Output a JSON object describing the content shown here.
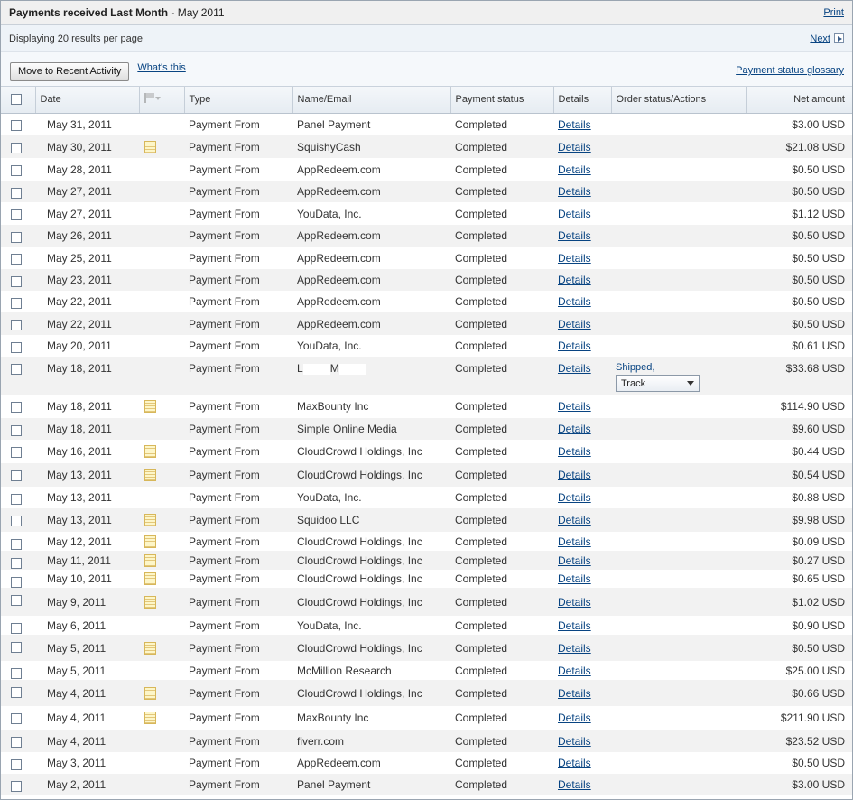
{
  "header": {
    "title_bold": "Payments received Last Month",
    "title_suffix": " - May 2011",
    "print_label": "Print"
  },
  "info": {
    "results_text": "Displaying 20 results per page",
    "next_label": "Next"
  },
  "actions": {
    "move_button": "Move to Recent Activity",
    "whats_this": "What's this",
    "glossary": "Payment status glossary"
  },
  "columns": {
    "date": "Date",
    "type": "Type",
    "name": "Name/Email",
    "status": "Payment status",
    "details": "Details",
    "order": "Order status/Actions",
    "amount": "Net amount"
  },
  "rows": [
    {
      "date": "May 31, 2011",
      "note": false,
      "type": "Payment From",
      "name": "Panel Payment",
      "status": "Completed",
      "details": "Details",
      "amount": "$3.00 USD"
    },
    {
      "date": "May 30, 2011",
      "note": true,
      "type": "Payment From",
      "name": "SquishyCash",
      "status": "Completed",
      "details": "Details",
      "amount": "$21.08 USD"
    },
    {
      "date": "May 28, 2011",
      "note": false,
      "type": "Payment From",
      "name": "AppRedeem.com",
      "status": "Completed",
      "details": "Details",
      "amount": "$0.50 USD"
    },
    {
      "date": "May 27, 2011",
      "note": false,
      "type": "Payment From",
      "name": "AppRedeem.com",
      "status": "Completed",
      "details": "Details",
      "amount": "$0.50 USD"
    },
    {
      "date": "May 27, 2011",
      "note": false,
      "type": "Payment From",
      "name": "YouData, Inc.",
      "status": "Completed",
      "details": "Details",
      "amount": "$1.12 USD"
    },
    {
      "date": "May 26, 2011",
      "note": false,
      "type": "Payment From",
      "name": "AppRedeem.com",
      "status": "Completed",
      "details": "Details",
      "amount": "$0.50 USD"
    },
    {
      "date": "May 25, 2011",
      "note": false,
      "type": "Payment From",
      "name": "AppRedeem.com",
      "status": "Completed",
      "details": "Details",
      "amount": "$0.50 USD"
    },
    {
      "date": "May 23, 2011",
      "note": false,
      "type": "Payment From",
      "name": "AppRedeem.com",
      "status": "Completed",
      "details": "Details",
      "amount": "$0.50 USD"
    },
    {
      "date": "May 22, 2011",
      "note": false,
      "type": "Payment From",
      "name": "AppRedeem.com",
      "status": "Completed",
      "details": "Details",
      "amount": "$0.50 USD"
    },
    {
      "date": "May 22, 2011",
      "note": false,
      "type": "Payment From",
      "name": "AppRedeem.com",
      "status": "Completed",
      "details": "Details",
      "amount": "$0.50 USD"
    },
    {
      "date": "May 20, 2011",
      "note": false,
      "type": "Payment From",
      "name": "YouData, Inc.",
      "status": "Completed",
      "details": "Details",
      "amount": "$0.61 USD"
    },
    {
      "date": "May 18, 2011",
      "note": false,
      "type": "Payment From",
      "name": "L M",
      "name_a": "L",
      "name_b": "M",
      "redacted": true,
      "status": "Completed",
      "details": "Details",
      "order_status": "Shipped",
      "order_action": "Track",
      "amount": "$33.68 USD"
    },
    {
      "date": "May 18, 2011",
      "note": true,
      "type": "Payment From",
      "name": "MaxBounty Inc",
      "status": "Completed",
      "details": "Details",
      "amount": "$114.90 USD"
    },
    {
      "date": "May 18, 2011",
      "note": false,
      "type": "Payment From",
      "name": "Simple Online Media",
      "status": "Completed",
      "details": "Details",
      "amount": "$9.60 USD"
    },
    {
      "date": "May 16, 2011",
      "note": true,
      "type": "Payment From",
      "name": "CloudCrowd Holdings, Inc",
      "status": "Completed",
      "details": "Details",
      "amount": "$0.44 USD"
    },
    {
      "date": "May 13, 2011",
      "note": true,
      "type": "Payment From",
      "name": "CloudCrowd Holdings, Inc",
      "status": "Completed",
      "details": "Details",
      "amount": "$0.54 USD"
    },
    {
      "date": "May 13, 2011",
      "note": false,
      "type": "Payment From",
      "name": "YouData, Inc.",
      "status": "Completed",
      "details": "Details",
      "amount": "$0.88 USD"
    },
    {
      "date": "May 13, 2011",
      "note": true,
      "type": "Payment From",
      "name": "Squidoo LLC",
      "status": "Completed",
      "details": "Details",
      "amount": "$9.98 USD"
    },
    {
      "date": "May 12, 2011",
      "note": true,
      "type": "Payment From",
      "name": "CloudCrowd Holdings, Inc",
      "status": "Completed",
      "details": "Details",
      "amount": "$0.09 USD"
    },
    {
      "date": "May 11, 2011",
      "note": true,
      "type": "Payment From",
      "name": "CloudCrowd Holdings, Inc",
      "status": "Completed",
      "details": "Details",
      "amount": "$0.27 USD"
    },
    {
      "date": "May 10, 2011",
      "note": true,
      "type": "Payment From",
      "name": "CloudCrowd Holdings, Inc",
      "status": "Completed",
      "details": "Details",
      "amount": "$0.65 USD"
    },
    {
      "date": "May 9, 2011",
      "note": true,
      "type": "Payment From",
      "name": "CloudCrowd Holdings, Inc",
      "status": "Completed",
      "details": "Details",
      "amount": "$1.02 USD"
    },
    {
      "date": "May 6, 2011",
      "note": false,
      "type": "Payment From",
      "name": "YouData, Inc.",
      "status": "Completed",
      "details": "Details",
      "amount": "$0.90 USD"
    },
    {
      "date": "May 5, 2011",
      "note": true,
      "type": "Payment From",
      "name": "CloudCrowd Holdings, Inc",
      "status": "Completed",
      "details": "Details",
      "amount": "$0.50 USD"
    },
    {
      "date": "May 5, 2011",
      "note": false,
      "type": "Payment From",
      "name": "McMillion Research",
      "status": "Completed",
      "details": "Details",
      "amount": "$25.00 USD"
    },
    {
      "date": "May 4, 2011",
      "note": true,
      "type": "Payment From",
      "name": "CloudCrowd Holdings, Inc",
      "status": "Completed",
      "details": "Details",
      "amount": "$0.66 USD"
    },
    {
      "date": "May 4, 2011",
      "note": true,
      "type": "Payment From",
      "name": "MaxBounty Inc",
      "status": "Completed",
      "details": "Details",
      "amount": "$211.90 USD"
    },
    {
      "date": "May 4, 2011",
      "note": false,
      "type": "Payment From",
      "name": "fiverr.com",
      "status": "Completed",
      "details": "Details",
      "amount": "$23.52 USD"
    },
    {
      "date": "May 3, 2011",
      "note": false,
      "type": "Payment From",
      "name": "AppRedeem.com",
      "status": "Completed",
      "details": "Details",
      "amount": "$0.50 USD"
    },
    {
      "date": "May 2, 2011",
      "note": false,
      "type": "Payment From",
      "name": "Panel Payment",
      "status": "Completed",
      "details": "Details",
      "amount": "$3.00 USD"
    }
  ],
  "icons": {
    "note": "note-icon",
    "flag": "flag-icon",
    "next": "next-arrow-icon"
  }
}
